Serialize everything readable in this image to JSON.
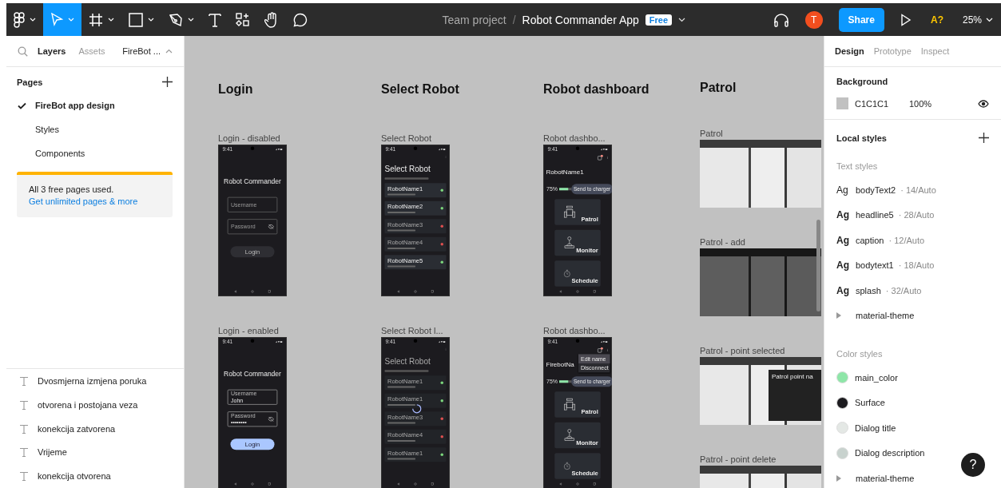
{
  "toolbar": {
    "tools": [
      {
        "kind": "main-menu",
        "selected": false
      },
      {
        "kind": "move",
        "selected": true
      },
      {
        "kind": "frame",
        "selected": false
      },
      {
        "kind": "shape",
        "selected": false
      },
      {
        "kind": "pen",
        "selected": false
      },
      {
        "kind": "text",
        "selected": false
      },
      {
        "kind": "resources",
        "selected": false
      },
      {
        "kind": "hand",
        "selected": false
      },
      {
        "kind": "comment",
        "selected": false
      }
    ]
  },
  "file": {
    "project": "Team project",
    "separator": "/",
    "name": "Robot Commander App",
    "plan": "Free"
  },
  "user": {
    "initial": "T"
  },
  "share": "Share",
  "missing_fonts": "A?",
  "zoom": "25%",
  "left_panel": {
    "tabs": [
      {
        "label": "Layers",
        "selected": true
      },
      {
        "label": "Assets",
        "selected": false
      }
    ],
    "page_menu": "FireBot ...",
    "pages_heading": "Pages",
    "pages": [
      {
        "label": "FireBot app design",
        "selected": true
      },
      {
        "label": "Styles",
        "selected": false
      },
      {
        "label": "Components",
        "selected": false
      }
    ],
    "notice": {
      "text": "All 3 free pages used.",
      "link": "Get unlimited pages & more"
    },
    "layers": [
      "Dvosmjerna izmjena poruka",
      "otvorena i postojana veza",
      "konekcija zatvorena",
      "Vrijeme",
      "konekcija otvorena"
    ]
  },
  "canvas": {
    "columns": [
      {
        "title": "Login",
        "frames": [
          {
            "label": "Login - disabled",
            "kind": "login",
            "time": "9:41",
            "title": "Robot Commander",
            "enabled": false,
            "fields": [
              {
                "placeholder": "Username"
              },
              {
                "placeholder": "Password"
              }
            ],
            "button": "Login"
          },
          {
            "label": "Login - enabled",
            "kind": "login",
            "time": "9:41",
            "title": "Robot Commander",
            "enabled": true,
            "fields": [
              {
                "label": "Username",
                "value": "John"
              },
              {
                "label": "Password",
                "value": "••••••••"
              }
            ],
            "button": "Login"
          }
        ]
      },
      {
        "title": "Select Robot",
        "frames": [
          {
            "label": "Select Robot",
            "kind": "select",
            "time": "9:41",
            "title": "Select Robot",
            "loading": false,
            "robots": [
              {
                "name": "RobotName1",
                "available": true
              },
              {
                "name": "RobotName2",
                "available": true
              },
              {
                "name": "RobotName3",
                "available": false
              },
              {
                "name": "RobotName4",
                "available": false
              },
              {
                "name": "RobotName5",
                "available": true
              }
            ]
          },
          {
            "label": "Select Robot l...",
            "kind": "select",
            "time": "9:41",
            "title": "Select Robot",
            "loading": true,
            "robots": [
              {
                "name": "RobotName1",
                "available": true
              },
              {
                "name": "RobotName1",
                "available": true
              },
              {
                "name": "RobotName3",
                "available": false
              },
              {
                "name": "RobotName4",
                "available": false
              },
              {
                "name": "RobotName1",
                "available": true
              }
            ]
          }
        ]
      },
      {
        "title": "Robot dashboard",
        "frames": [
          {
            "label": "Robot dashbo...",
            "kind": "dashboard",
            "time": "9:41",
            "robot": "RobotName1",
            "battery": "75%",
            "level": 0.75,
            "charge_button": "Send to charger",
            "actions": [
              "Patrol",
              "Monitor",
              "Schedule"
            ]
          },
          {
            "label": "Robot dashbo...",
            "kind": "dashboard",
            "time": "9:41",
            "robot": "FirebotNa",
            "battery": "75%",
            "level": 0.75,
            "charge_button": "Send to charger",
            "actions": [
              "Patrol",
              "Monitor",
              "Schedule"
            ],
            "menu": [
              {
                "label": "Edit name",
                "selected": true
              },
              {
                "label": "Disconnect",
                "selected": false
              }
            ]
          }
        ]
      },
      {
        "title": "Patrol",
        "frames": [
          {
            "label": "Patrol",
            "kind": "map",
            "dimmed": false
          },
          {
            "label": "Patrol - add",
            "kind": "map",
            "dimmed": true
          },
          {
            "label": "Patrol - point selected",
            "kind": "map",
            "dimmed": false,
            "dialog": "Patrol point na"
          },
          {
            "label": "Patrol - point delete",
            "kind": "map",
            "dimmed": false
          }
        ]
      }
    ]
  },
  "right_panel": {
    "tabs": [
      {
        "label": "Design",
        "selected": true
      },
      {
        "label": "Prototype",
        "selected": false
      },
      {
        "label": "Inspect",
        "selected": false
      }
    ],
    "background": {
      "heading": "Background",
      "color": "#c1c1c1",
      "hex": "C1C1C1",
      "opacity": "100%"
    },
    "local_styles": "Local styles",
    "text_styles": {
      "heading": "Text styles",
      "items": [
        {
          "sample": "Ag",
          "bold": false,
          "name": "bodyText2",
          "detail": "· 14/Auto"
        },
        {
          "sample": "Ag",
          "bold": true,
          "name": "headline5",
          "detail": "· 28/Auto"
        },
        {
          "sample": "Ag",
          "bold": true,
          "name": "caption",
          "detail": "· 12/Auto"
        },
        {
          "sample": "Ag",
          "bold": true,
          "name": "bodytext1",
          "detail": "· 18/Auto"
        },
        {
          "sample": "Ag",
          "bold": true,
          "name": "splash",
          "detail": "· 32/Auto"
        }
      ],
      "group": {
        "label": "material-theme",
        "expanded": false
      }
    },
    "color_styles": {
      "heading": "Color styles",
      "items": [
        {
          "name": "main_color",
          "color": "#8ee6a8"
        },
        {
          "name": "Surface",
          "color": "#1c1b1f"
        },
        {
          "name": "Dialog title",
          "color": "#e4e8e5"
        },
        {
          "name": "Dialog description",
          "color": "#c8d2ce"
        }
      ],
      "group": {
        "label": "material-theme",
        "expanded": false
      }
    }
  },
  "help": "?"
}
